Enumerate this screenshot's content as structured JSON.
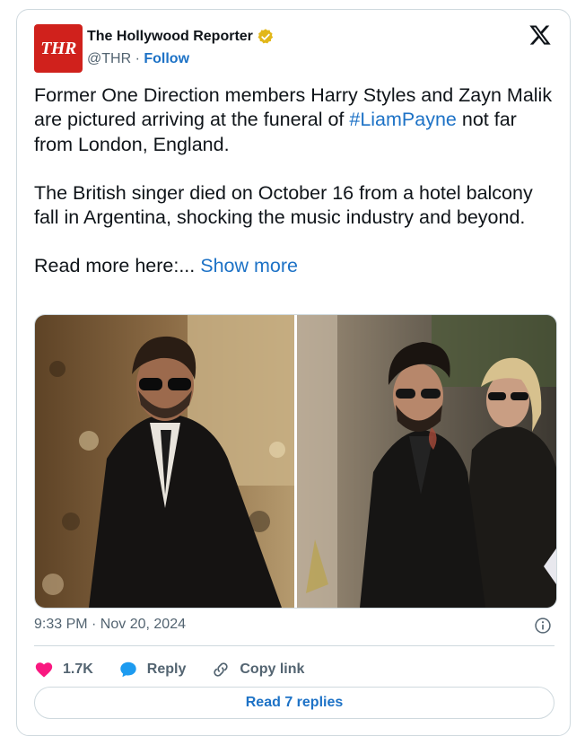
{
  "account": {
    "logo_text": "THR",
    "name": "The Hollywood Reporter",
    "handle": "@THR",
    "separator": "·",
    "follow_label": "Follow"
  },
  "tweet": {
    "line1_pre": "Former One Direction members Harry Styles and Zayn Malik are pictured arriving at the funeral of ",
    "hashtag": "#LiamPayne",
    "line1_post": " not far from London, England.",
    "para2": "The British singer died on October 16 from a hotel balcony fall in Argentina, shocking the music industry and beyond.",
    "read_more": "Read more here:... ",
    "show_more": "Show more"
  },
  "timestamp": "9:33 PM · Nov 20, 2024",
  "actions": {
    "like_count": "1.7K",
    "reply_label": "Reply",
    "copy_label": "Copy link"
  },
  "read_replies_label": "Read 7 replies",
  "colors": {
    "brand_red": "#d0211c",
    "link_blue": "#1d72c6",
    "heart_pink": "#f91880",
    "reply_blue": "#1d9bf0",
    "verified_gold": "#e2b719"
  },
  "icons": [
    "verified-badge-icon",
    "x-logo-icon",
    "info-icon",
    "heart-icon",
    "reply-bubble-icon",
    "link-icon"
  ]
}
